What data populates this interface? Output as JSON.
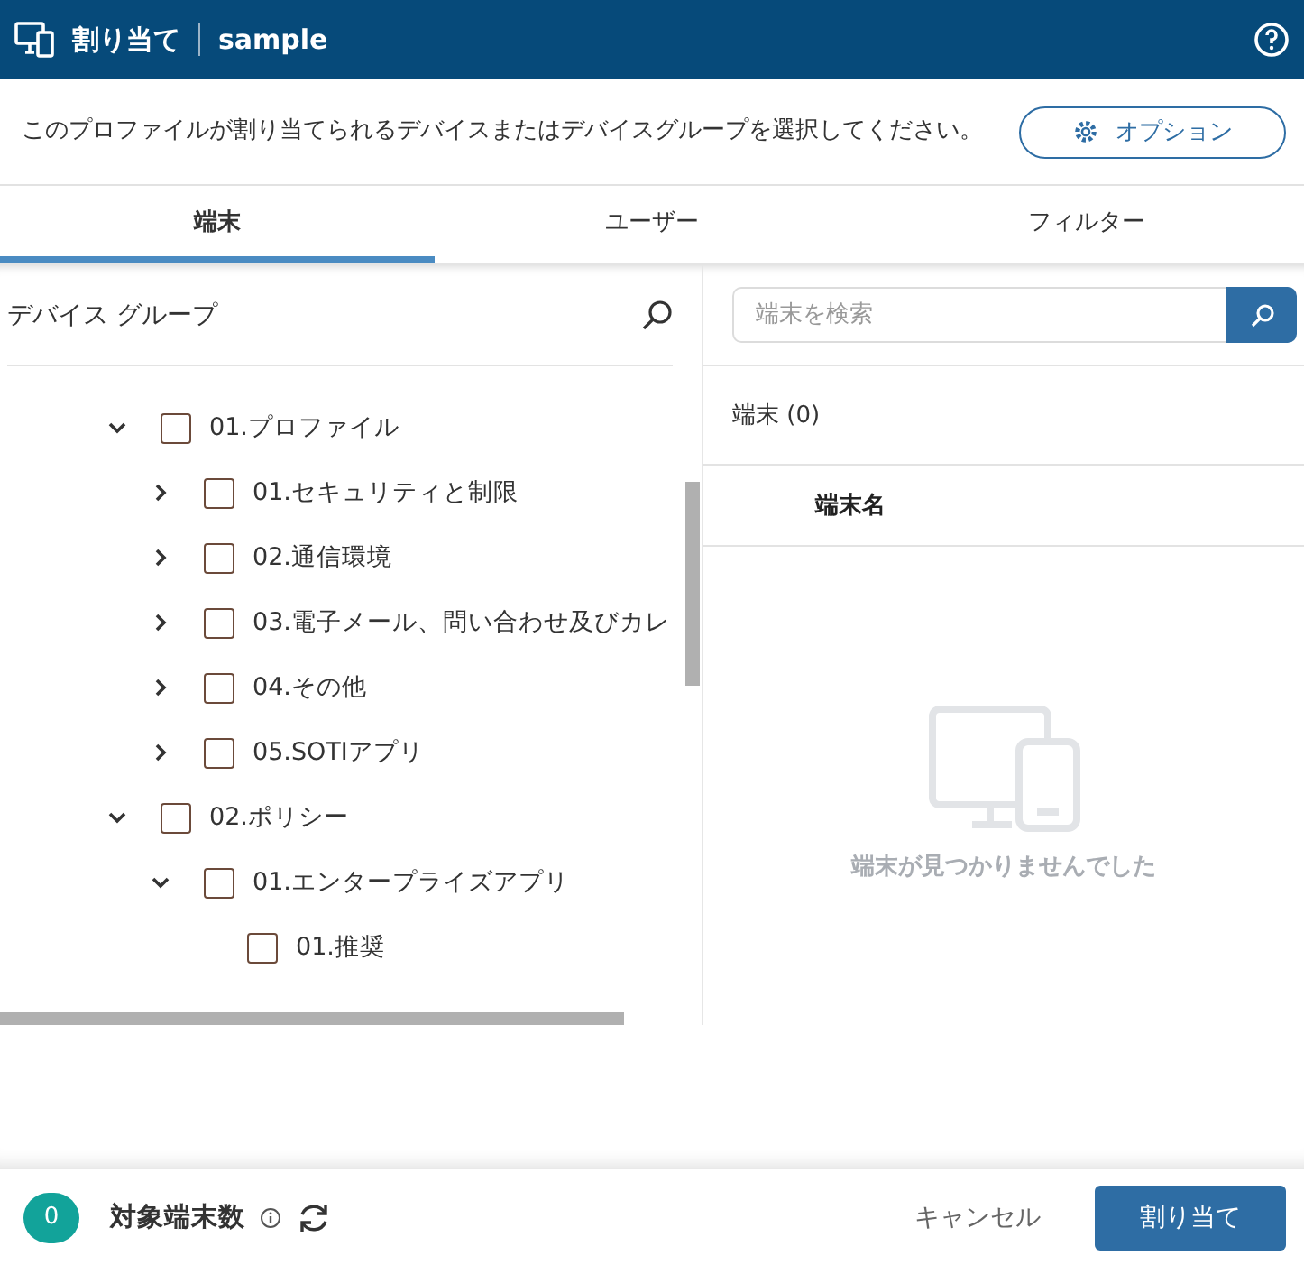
{
  "header": {
    "title": "割り当て",
    "subtitle": "sample"
  },
  "description": "このプロファイルが割り当てられるデバイスまたはデバイスグループを選択してください。",
  "options_button": "オプション",
  "tabs": [
    {
      "label": "端末",
      "selected": true
    },
    {
      "label": "ユーザー",
      "selected": false
    },
    {
      "label": "フィルター",
      "selected": false
    }
  ],
  "group_panel": {
    "title": "デバイス グループ",
    "tree": [
      {
        "label": "01.プロファイル",
        "checked": false,
        "expanded": true,
        "children": [
          {
            "label": "01.セキュリティと制限",
            "checked": false,
            "expanded": false
          },
          {
            "label": "02.通信環境",
            "checked": false,
            "expanded": false
          },
          {
            "label": "03.電子メール、問い合わせ及びカレ",
            "checked": false,
            "expanded": false
          },
          {
            "label": "04.その他",
            "checked": false,
            "expanded": false
          },
          {
            "label": "05.SOTIアプリ",
            "checked": false,
            "expanded": false
          }
        ]
      },
      {
        "label": "02.ポリシー",
        "checked": false,
        "expanded": true,
        "children": [
          {
            "label": "01.エンタープライズアプリ",
            "checked": false,
            "expanded": true,
            "children": [
              {
                "label": "01.推奨",
                "checked": false
              }
            ]
          }
        ]
      }
    ]
  },
  "device_panel": {
    "search": {
      "placeholder": "端末を検索"
    },
    "count_label": "端末 (0)",
    "columns": [
      "端末名"
    ],
    "empty_text": "端末が見つかりませんでした"
  },
  "footer": {
    "count": "0",
    "count_label": "対象端末数",
    "cancel": "キャンセル",
    "assign": "割り当て"
  }
}
